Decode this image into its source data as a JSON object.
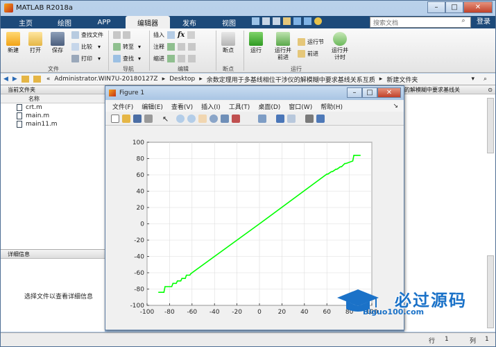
{
  "app": {
    "title": "MATLAB R2018a"
  },
  "tabs": [
    {
      "label": "主页",
      "active": false
    },
    {
      "label": "绘图",
      "active": false
    },
    {
      "label": "APP",
      "active": false
    },
    {
      "label": "编辑器",
      "active": true
    },
    {
      "label": "发布",
      "active": false
    },
    {
      "label": "视图",
      "active": false
    }
  ],
  "search": {
    "placeholder": "搜索文档"
  },
  "login_label": "登录",
  "ribbon": {
    "file": {
      "group": "文件",
      "new": "新建",
      "open": "打开",
      "save": "保存",
      "find_files": "查找文件",
      "compare": "比较",
      "print": "打印"
    },
    "navigate": {
      "group": "导航",
      "goto": "转至",
      "find": "查找"
    },
    "edit": {
      "group": "编辑",
      "insert": "插入",
      "comment": "注释",
      "indent": "缩进"
    },
    "breakpoints": {
      "group": "断点",
      "breakpoints": "断点"
    },
    "run": {
      "group": "运行",
      "run": "运行",
      "run_advance": "运行并\n前进",
      "run_section": "运行节",
      "advance": "前进",
      "run_time": "运行并\n计时"
    }
  },
  "address": {
    "parts": [
      "Administrator.WIN7U-20180127Z",
      "Desktop",
      "余数定理用于多基线相位干涉仪的解模糊中要求基线关系互质",
      "新建文件夹"
    ]
  },
  "left_pane": {
    "header": "当前文件夹",
    "column": "名称",
    "files": [
      "crt.m",
      "main.m",
      "main11.m"
    ],
    "details_header": "详细信息",
    "details_msg": "选择文件以查看详细信息"
  },
  "right_pane": {
    "header_fragment": "的解模糊中要求基线关"
  },
  "status": {
    "row_label": "行",
    "row": "1",
    "col_label": "列",
    "col": "1"
  },
  "figure": {
    "title": "Figure 1",
    "menu": [
      "文件(F)",
      "编辑(E)",
      "查看(V)",
      "插入(I)",
      "工具(T)",
      "桌面(D)",
      "窗口(W)",
      "帮助(H)"
    ]
  },
  "watermark": {
    "text": "必过源码",
    "url": "Biguo100.com"
  },
  "colors": {
    "line": "#00ff00",
    "tabbar": "#1d4a7a",
    "axes_bg": "#ffffff"
  },
  "chart_data": {
    "type": "line",
    "xlim": [
      -100,
      100
    ],
    "ylim": [
      -100,
      100
    ],
    "xticks": [
      -100,
      -80,
      -60,
      -40,
      -20,
      0,
      20,
      40,
      60,
      80,
      100
    ],
    "yticks": [
      -100,
      -80,
      -60,
      -40,
      -20,
      0,
      20,
      40,
      60,
      80,
      100
    ],
    "grid": true,
    "series": [
      {
        "color": "#00ff00",
        "x": [
          -90,
          -85,
          -84,
          -78,
          -77,
          -74,
          -73,
          -70,
          -69,
          -66,
          -65,
          -62,
          -61,
          0,
          60,
          61,
          64,
          65,
          68,
          69,
          72,
          73,
          76,
          77,
          83,
          84,
          90
        ],
        "y": [
          -84,
          -84,
          -77,
          -77,
          -73,
          -73,
          -70,
          -70,
          -67,
          -67,
          -63,
          -63,
          -61,
          0,
          61,
          61,
          64,
          64,
          67,
          67,
          70,
          70,
          74,
          74,
          77,
          84,
          84
        ]
      }
    ]
  }
}
